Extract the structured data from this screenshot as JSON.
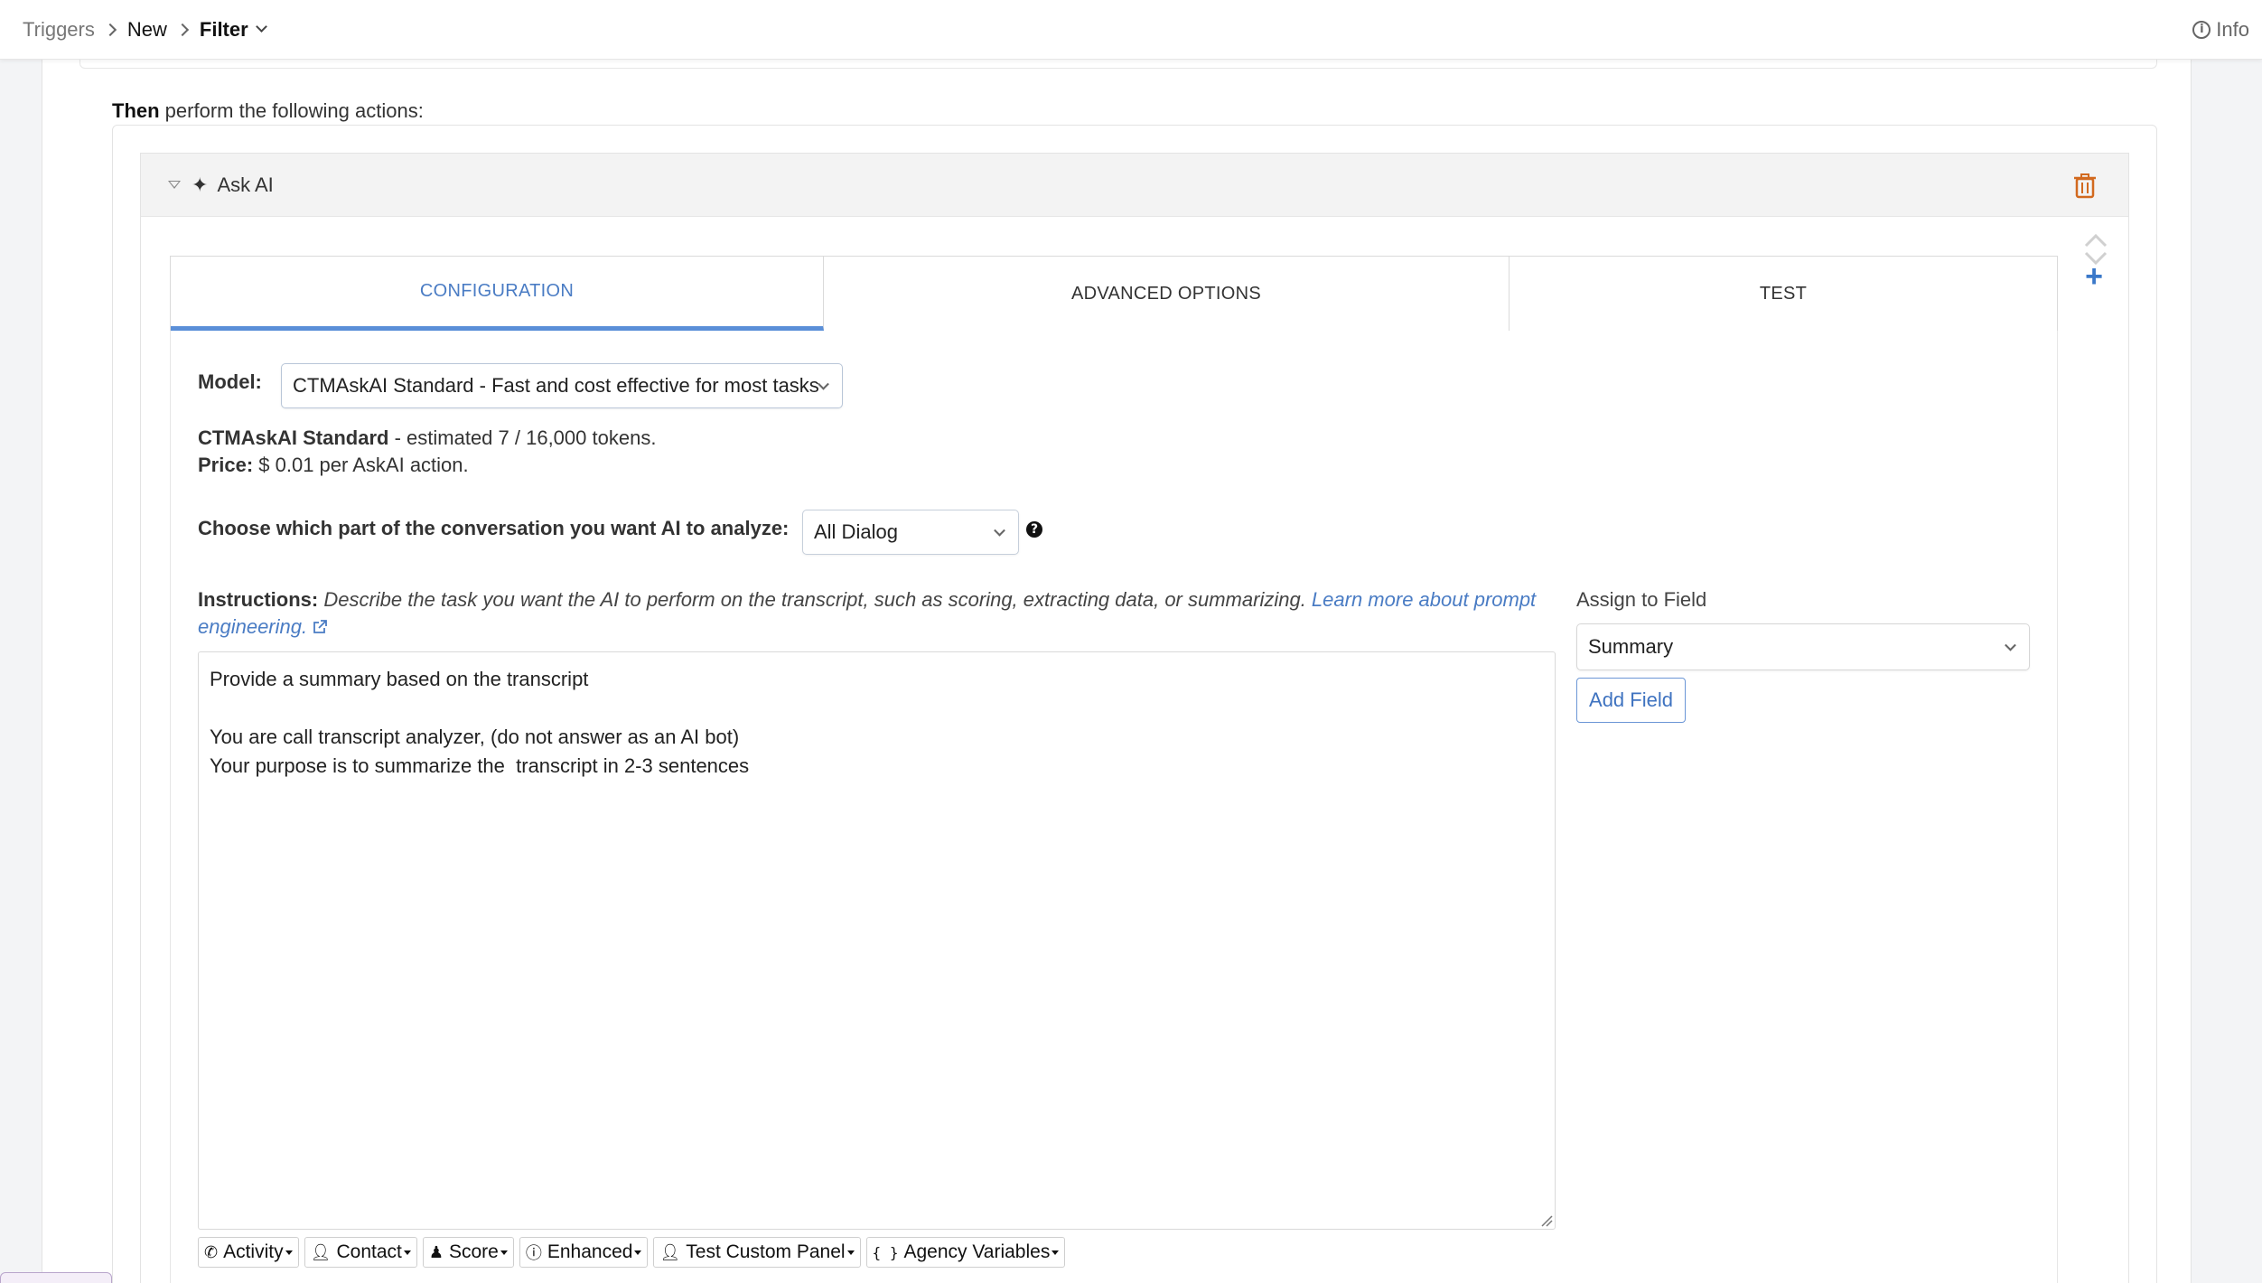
{
  "breadcrumb": {
    "items": [
      "Triggers",
      "New",
      "Filter"
    ],
    "info_label": "Info"
  },
  "then_line": {
    "bold": "Then",
    "rest": " perform the following actions:"
  },
  "action": {
    "title": "Ask AI"
  },
  "tabs": [
    "CONFIGURATION",
    "ADVANCED OPTIONS",
    "TEST"
  ],
  "config": {
    "model_label": "Model:",
    "model_value": "CTMAskAI Standard - Fast and cost effective for most tasks",
    "estimate_name": "CTMAskAI Standard",
    "estimate_rest": " - estimated 7 / 16,000 tokens.",
    "price_label": "Price:",
    "price_value": " $ 0.01 per AskAI action.",
    "choose_label": "Choose which part of the conversation you want AI to analyze:",
    "dialog_value": "All Dialog",
    "instructions_label": "Instructions:",
    "instructions_desc": " Describe the task you want the AI to perform on the transcript, such as scoring, extracting data, or summarizing. ",
    "instructions_link": "Learn more about prompt engineering.",
    "instructions_text": "Provide a summary based on the transcript\n\nYou are call transcript analyzer, (do not answer as an AI bot)\nYour purpose is to summarize the  transcript in 2-3 sentences",
    "assign_label": "Assign to Field",
    "assign_value": "Summary",
    "add_field_label": "Add Field"
  },
  "toolbar": [
    {
      "label": "Activity",
      "icon": "phone-icon"
    },
    {
      "label": "Contact",
      "icon": "user-icon"
    },
    {
      "label": "Score",
      "icon": "score-icon"
    },
    {
      "label": "Enhanced",
      "icon": "info-circle-icon"
    },
    {
      "label": "Test Custom Panel",
      "icon": "user-icon"
    },
    {
      "label": "Agency Variables",
      "icon": "braces-icon"
    }
  ],
  "colors": {
    "accent": "#4a7cc4",
    "trash": "#d2691e"
  }
}
